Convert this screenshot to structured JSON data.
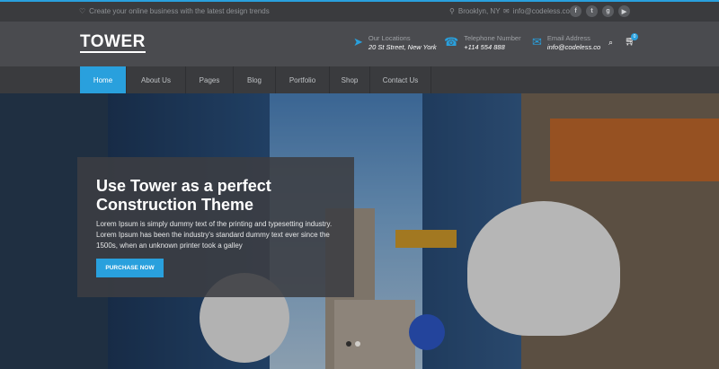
{
  "topbar": {
    "tagline": "Create your online business with the latest design trends",
    "location": "Brooklyn, NY",
    "email": "info@codeless.co",
    "social": [
      {
        "icon": "facebook-icon",
        "glyph": "f"
      },
      {
        "icon": "twitter-icon",
        "glyph": "t"
      },
      {
        "icon": "google-plus-icon",
        "glyph": "g"
      },
      {
        "icon": "youtube-icon",
        "glyph": "▶"
      }
    ]
  },
  "header": {
    "logo": "TOWER",
    "location": {
      "label": "Our Locations",
      "value": "20 St Street, New York"
    },
    "phone": {
      "label": "Telephone Number",
      "value": "+114 554 888"
    },
    "email": {
      "label": "Email Address",
      "value": "info@codeless.co"
    },
    "cart_count": "0"
  },
  "nav": [
    {
      "label": "Home",
      "active": true
    },
    {
      "label": "About Us"
    },
    {
      "label": "Pages"
    },
    {
      "label": "Blog"
    },
    {
      "label": "Portfolio"
    },
    {
      "label": "Shop"
    },
    {
      "label": "Contact Us"
    }
  ],
  "hero": {
    "title": "Use Tower as a perfect Construction Theme",
    "text": "Lorem Ipsum is simply dummy text of the printing and typesetting industry. Lorem Ipsum has been the industry's standard dummy text ever since the 1500s, when an unknown printer took a galley",
    "cta": "PURCHASE NOW"
  },
  "colors": {
    "accent": "#29a0dd",
    "header_bg": "#4a4b4f",
    "nav_bg": "#3a3b3e"
  }
}
